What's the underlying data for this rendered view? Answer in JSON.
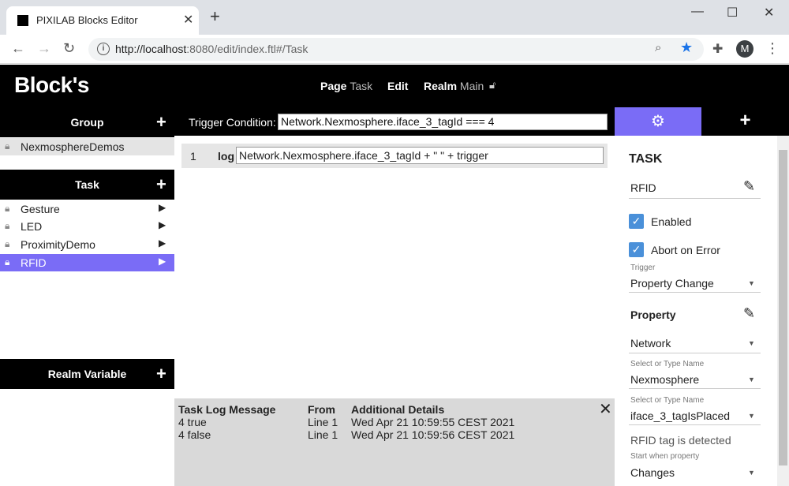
{
  "browser": {
    "tab_title": "PIXILAB Blocks Editor",
    "url_host": "http://localhost",
    "url_rest": ":8080/edit/index.ftl#/Task",
    "avatar_letter": "M"
  },
  "header": {
    "logo": "Block's",
    "nav": [
      {
        "label": "Page",
        "sub": "Task"
      },
      {
        "label": "Edit",
        "sub": ""
      },
      {
        "label": "Realm",
        "sub": "Main"
      }
    ]
  },
  "left": {
    "group_label": "Group",
    "groups": [
      "NexmosphereDemos"
    ],
    "task_label": "Task",
    "tasks": [
      "Gesture",
      "LED",
      "ProximityDemo",
      "RFID"
    ],
    "selected_task": "RFID",
    "realm_label": "Realm Variable"
  },
  "trigger": {
    "label": "Trigger Condition:",
    "value": "Network.Nexmosphere.iface_3_tagId === 4"
  },
  "editor": {
    "line_number": "1",
    "command": "log",
    "argument": "Network.Nexmosphere.iface_3_tagId + \" \" + trigger"
  },
  "log": {
    "headers": [
      "Task Log Message",
      "From",
      "Additional Details"
    ],
    "rows": [
      [
        "4 true",
        "Line 1",
        "Wed Apr 21 10:59:55 CEST 2021"
      ],
      [
        "4 false",
        "Line 1",
        "Wed Apr 21 10:59:56 CEST 2021"
      ]
    ]
  },
  "inspector": {
    "title": "TASK",
    "task_name": "RFID",
    "enabled_label": "Enabled",
    "abort_label": "Abort on Error",
    "trigger_caption": "Trigger",
    "trigger_value": "Property Change",
    "property_title": "Property",
    "property_root": "Network",
    "select_caption_1": "Select or Type Name",
    "select_value_1": "Nexmosphere",
    "select_caption_2": "Select or Type Name",
    "select_value_2": "iface_3_tagIsPlaced",
    "description": "RFID tag is detected",
    "start_caption": "Start when property",
    "start_value": "Changes"
  },
  "colors": {
    "accent": "#7a6cf6",
    "check": "#4a90d9"
  }
}
